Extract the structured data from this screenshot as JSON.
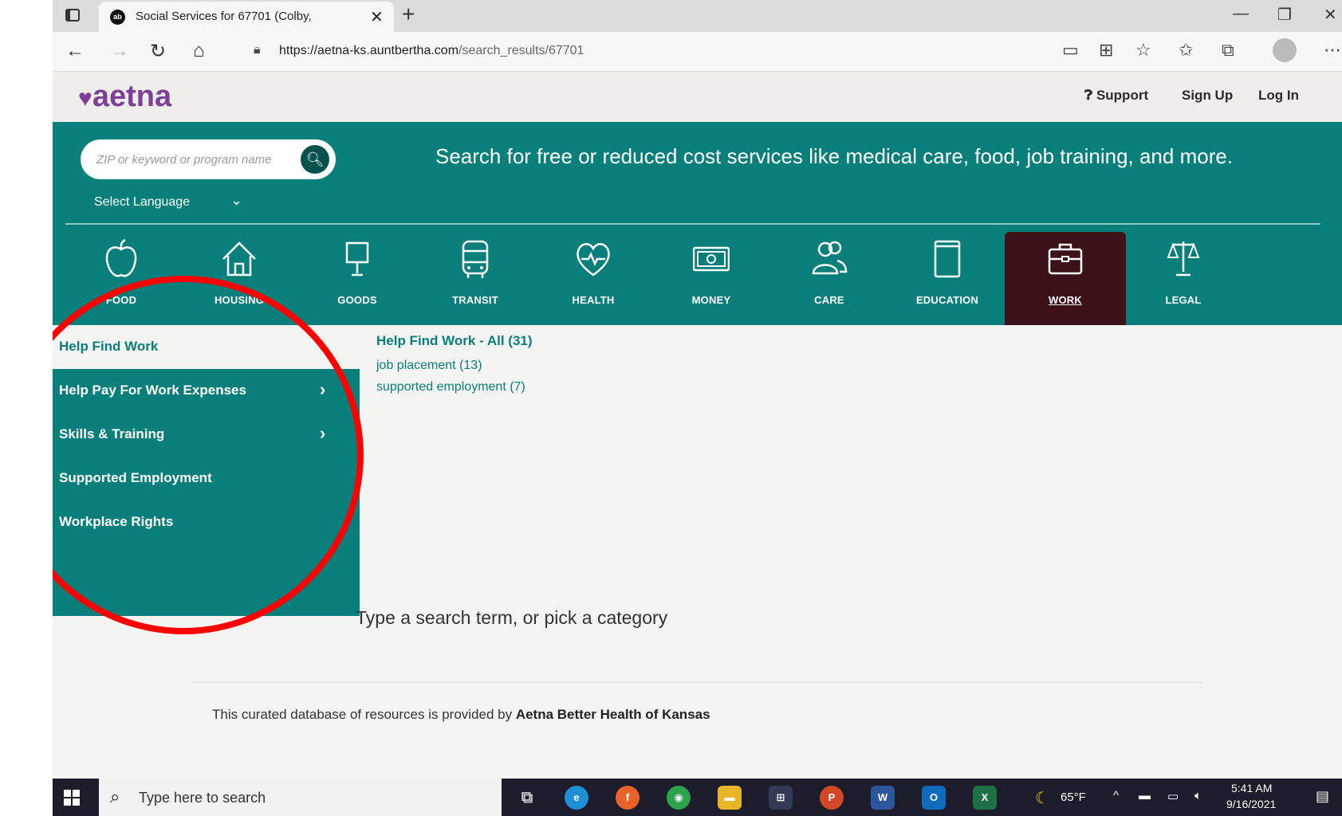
{
  "browser": {
    "tab_title": "Social Services for 67701 (Colby,",
    "favicon_text": "ab",
    "url_domain": "https://aetna-ks.auntbertha.com",
    "url_path": "/search_results/67701"
  },
  "header": {
    "logo_text": "aetna",
    "links": [
      "Support",
      "Sign Up",
      "Log In"
    ]
  },
  "search": {
    "placeholder": "ZIP or keyword or program name",
    "tagline": "Search for free or reduced cost services like medical care, food, job training, and more.",
    "language_label": "Select Language"
  },
  "categories": [
    "FOOD",
    "HOUSING",
    "GOODS",
    "TRANSIT",
    "HEALTH",
    "MONEY",
    "CARE",
    "EDUCATION",
    "WORK",
    "LEGAL"
  ],
  "active_category": "WORK",
  "submenu": [
    {
      "label": "Help Find Work"
    },
    {
      "label": "Help Pay For Work Expenses"
    },
    {
      "label": "Skills & Training"
    },
    {
      "label": "Supported Employment"
    },
    {
      "label": "Workplace Rights"
    }
  ],
  "detail": {
    "title": "Help Find Work - All (31)",
    "links": [
      "job placement (13)",
      "supported employment (7)"
    ]
  },
  "page": {
    "prompt": "Type a search term, or pick a category",
    "footer_prefix": "This curated database of resources is provided by",
    "footer_org": "Aetna Better Health of Kansas"
  },
  "taskbar": {
    "search_text": "Type here to search",
    "weather": "65°F",
    "time": "5:41 AM",
    "date": "9/16/2021"
  },
  "colors": {
    "brand_purple": "#7d3f98",
    "teal": "#087f7b",
    "active_category_bg": "#3d1217",
    "annotation_red": "#ff0000"
  }
}
